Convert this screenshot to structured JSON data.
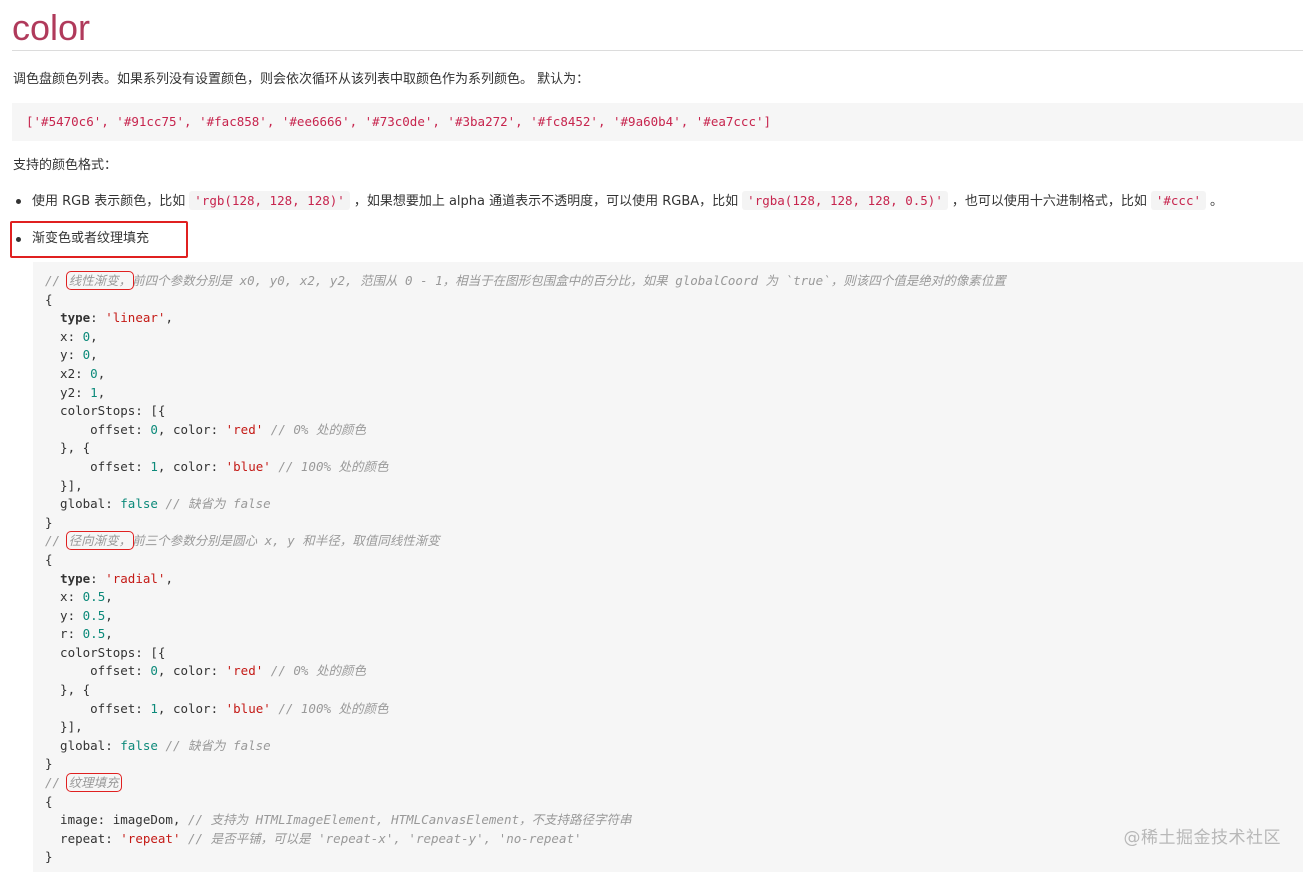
{
  "header": {
    "title": "color"
  },
  "intro": {
    "description": "调色盘颜色列表。如果系列没有设置颜色，则会依次循环从该列表中取颜色作为系列颜色。 默认为：",
    "default_value": "['#5470c6', '#91cc75', '#fac858', '#ee6666', '#73c0de', '#3ba272', '#fc8452', '#9a60b4', '#ea7ccc']"
  },
  "formats": {
    "heading": "支持的颜色格式：",
    "items": [
      {
        "p1": "使用 RGB 表示颜色，比如",
        "c1": "'rgb(128, 128, 128)'",
        "p2": "，如果想要加上 alpha 通道表示不透明度，可以使用 RGBA，比如",
        "c2": "'rgba(128, 128, 128, 0.5)'",
        "p3": "，也可以使用十六进制格式，比如",
        "c3": "'#ccc'",
        "p4": "。"
      },
      {
        "p1": "渐变色或者纹理填充"
      }
    ]
  },
  "code": {
    "c1_prefix": "// ",
    "c1_label": "线性渐变，",
    "c1_rest": "前四个参数分别是 x0, y0, x2, y2, 范围从 0 - 1，相当于在图形包围盒中的百分比，如果 globalCoord 为 `true`，则该四个值是绝对的像素位置",
    "type_key": "type",
    "linear": "'linear'",
    "radial": "'radial'",
    "red": "'red'",
    "blue": "'blue'",
    "zero_comment": "// 0% 处的颜色",
    "hundred_comment": "// 100% 处的颜色",
    "false_kw": "false",
    "global_comment": "// 缺省为 false",
    "c2_prefix": "// ",
    "c2_label": "径向渐变，",
    "c2_rest": "前三个参数分别是圆心 x, y 和半径，取值同线性渐变",
    "c3_prefix": "// ",
    "c3_label": "纹理填充",
    "image_comment": "// 支持为 HTMLImageElement, HTMLCanvasElement，不支持路径字符串",
    "repeat_value": "'repeat'",
    "repeat_comment": "// 是否平铺，可以是 'repeat-x', 'repeat-y', 'no-repeat'"
  },
  "watermark": "@稀土掘金技术社区"
}
